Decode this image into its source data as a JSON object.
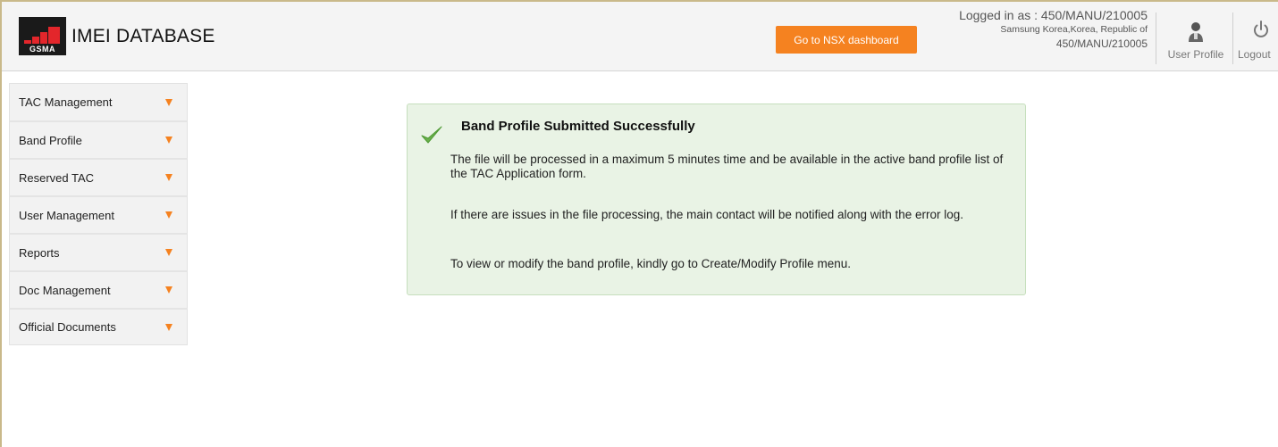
{
  "header": {
    "logo_text": "GSMA",
    "app_title": "IMEI DATABASE",
    "nsx_button_label": "Go to NSX dashboard",
    "login": {
      "logged_in_as": "Logged in as : 450/MANU/210005",
      "company": "Samsung Korea,Korea, Republic of",
      "account_id": "450/MANU/210005"
    },
    "user_profile_label": "User Profile",
    "logout_label": "Logout",
    "icons": {
      "user_profile": "user-icon",
      "logout": "power-icon"
    }
  },
  "sidebar": {
    "items": [
      {
        "label": "TAC Management"
      },
      {
        "label": "Band Profile"
      },
      {
        "label": "Reserved TAC"
      },
      {
        "label": "User Management"
      },
      {
        "label": "Reports"
      },
      {
        "label": "Doc Management"
      },
      {
        "label": "Official Documents"
      }
    ],
    "caret_icon": "caret-down-icon"
  },
  "alert": {
    "icon": "checkmark-icon",
    "title": "Band Profile Submitted Successfully",
    "paragraphs": [
      "The file will be processed in a maximum 5 minutes time and be available in the active band profile list of the TAC Application form.",
      "If there are issues in the file processing, the main contact will be notified along with the error log.",
      "To view or modify the band profile, kindly go to Create/Modify Profile menu."
    ]
  },
  "colors": {
    "accent": "#f58220",
    "brand_red": "#e3262b",
    "success_bg": "#e9f3e5",
    "success_border": "#c6dfbd",
    "check_green": "#6ab04c"
  }
}
